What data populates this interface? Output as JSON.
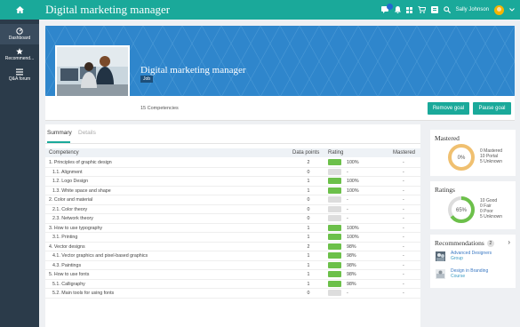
{
  "app": {
    "title": "Digital marketing manager",
    "user_name": "Sally Johnson"
  },
  "top_icons": [
    "chat-icon",
    "bell-icon",
    "grid-icon",
    "cart-icon",
    "list-icon",
    "search-icon"
  ],
  "sidebar": {
    "items": [
      {
        "label": "Dashboard",
        "icon": "dashboard-icon",
        "active": true
      },
      {
        "label": "Recommend...",
        "icon": "star-icon",
        "active": false
      },
      {
        "label": "Q&A forum",
        "icon": "forum-icon",
        "active": false
      }
    ]
  },
  "hero": {
    "title": "Digital marketing manager",
    "tag": "Job",
    "competency_count": "15 Competencies"
  },
  "actions": {
    "remove_goal": "Remove goal",
    "pause_goal": "Pause goal"
  },
  "tabs": [
    {
      "label": "Summary",
      "active": true
    },
    {
      "label": "Details",
      "active": false
    }
  ],
  "table": {
    "headers": {
      "competency": "Competency",
      "data_points": "Data points",
      "rating": "Rating",
      "mastered": "Mastered"
    },
    "rows": [
      {
        "name": "1. Principles of graphic design",
        "dp": "2",
        "pct": "100%",
        "rated": true,
        "sub": false,
        "mastered": "-"
      },
      {
        "name": "1.1. Alignment",
        "dp": "0",
        "pct": "-",
        "rated": false,
        "sub": true,
        "mastered": "-"
      },
      {
        "name": "1.2. Logo Design",
        "dp": "1",
        "pct": "100%",
        "rated": true,
        "sub": true,
        "mastered": "-"
      },
      {
        "name": "1.3. White space and shape",
        "dp": "1",
        "pct": "100%",
        "rated": true,
        "sub": true,
        "mastered": "-"
      },
      {
        "name": "2. Color and material",
        "dp": "0",
        "pct": "-",
        "rated": false,
        "sub": false,
        "mastered": "-"
      },
      {
        "name": "2.1. Color theory",
        "dp": "0",
        "pct": "-",
        "rated": false,
        "sub": true,
        "mastered": "-"
      },
      {
        "name": "2.3. Network theory",
        "dp": "0",
        "pct": "-",
        "rated": false,
        "sub": true,
        "mastered": "-"
      },
      {
        "name": "3. How to use typography",
        "dp": "1",
        "pct": "100%",
        "rated": true,
        "sub": false,
        "mastered": "-"
      },
      {
        "name": "3.1. Printing",
        "dp": "1",
        "pct": "100%",
        "rated": true,
        "sub": true,
        "mastered": "-"
      },
      {
        "name": "4. Vector designs",
        "dp": "2",
        "pct": "98%",
        "rated": true,
        "sub": false,
        "mastered": "-"
      },
      {
        "name": "4.1. Vector graphics and pixel-based graphics",
        "dp": "1",
        "pct": "98%",
        "rated": true,
        "sub": true,
        "mastered": "-"
      },
      {
        "name": "4.3. Paintings",
        "dp": "1",
        "pct": "98%",
        "rated": true,
        "sub": true,
        "mastered": "-"
      },
      {
        "name": "5. How to use fonts",
        "dp": "1",
        "pct": "98%",
        "rated": true,
        "sub": false,
        "mastered": "-"
      },
      {
        "name": "5.1. Calligraphy",
        "dp": "1",
        "pct": "98%",
        "rated": true,
        "sub": true,
        "mastered": "-"
      },
      {
        "name": "5.2. Main tools for using fonts",
        "dp": "0",
        "pct": "-",
        "rated": false,
        "sub": true,
        "mastered": "-"
      }
    ]
  },
  "mastered": {
    "title": "Mastered",
    "center": "0%",
    "fraction": 0.0,
    "stats": [
      "0 Mastered",
      "10 Portal",
      "5 Unknown"
    ]
  },
  "ratings": {
    "title": "Ratings",
    "center": "65%",
    "fraction": 0.65,
    "stats": [
      "10 Good",
      "0 Fair",
      "0 Poor",
      "5 Unknown"
    ]
  },
  "recommendations": {
    "title": "Recommendations",
    "count": "2",
    "items": [
      {
        "title": "Advanced Designers",
        "subtitle": "Group"
      },
      {
        "title": "Design in Branding",
        "subtitle": "Course"
      }
    ]
  },
  "colors": {
    "accent": "#1aa99a",
    "hero_blue": "#2f86cc",
    "bar_good": "#6cc04a",
    "bar_empty": "#dddddd",
    "donut_orange": "#f0c070",
    "donut_green": "#6cc04a"
  }
}
